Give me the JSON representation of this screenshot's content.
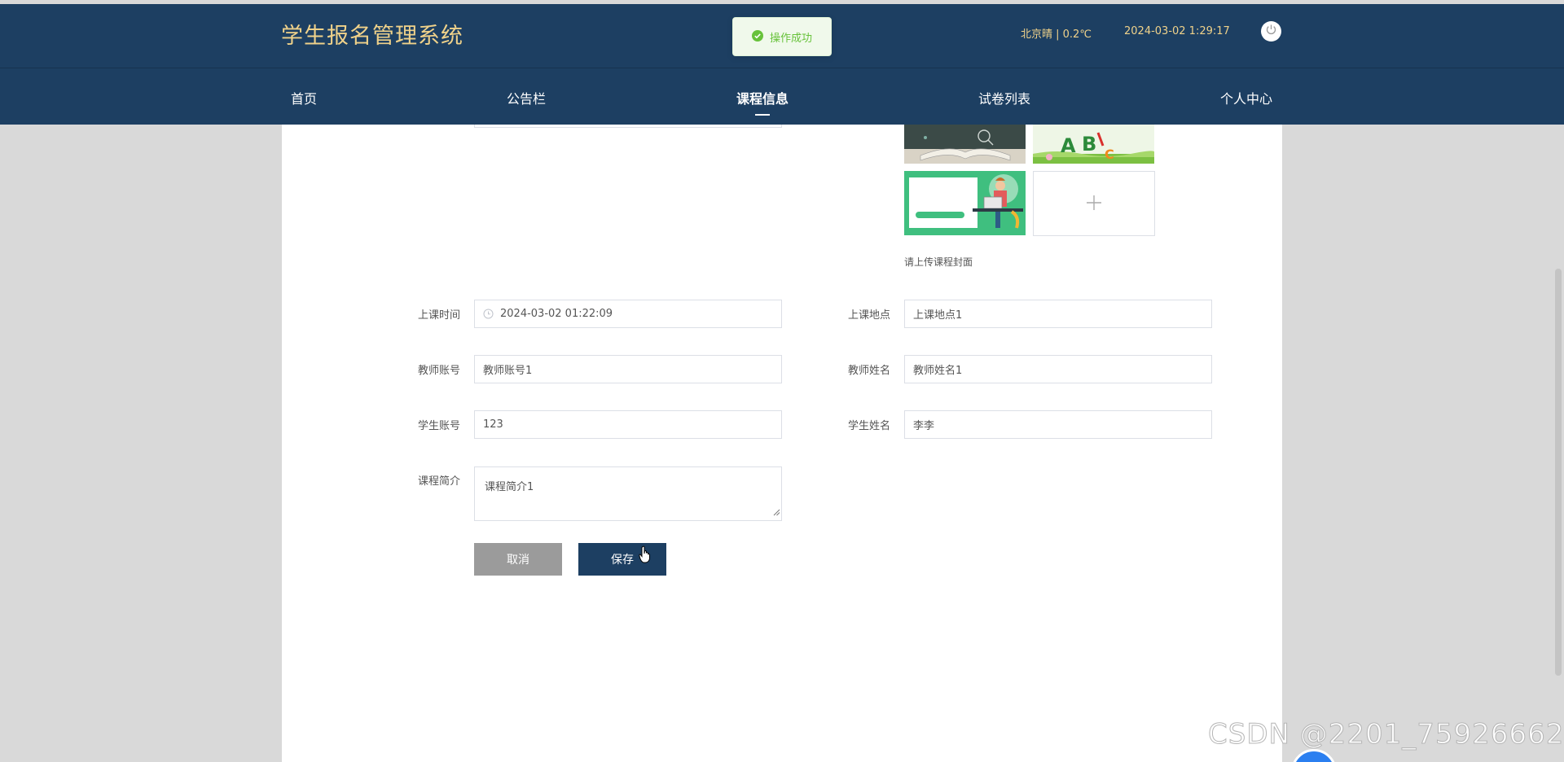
{
  "header": {
    "app_title": "学生报名管理系统",
    "weather": "北京晴 | 0.2℃",
    "datetime": "2024-03-02  1:29:17",
    "toast": "操作成功"
  },
  "nav": {
    "items": [
      {
        "label": "首页"
      },
      {
        "label": "公告栏"
      },
      {
        "label": "课程信息"
      },
      {
        "label": "试卷列表"
      },
      {
        "label": "个人中心"
      }
    ],
    "active": "课程信息"
  },
  "upload": {
    "tip": "请上传课程封面"
  },
  "form": {
    "course_time": {
      "label": "上课时间",
      "value": "2024-03-02 01:22:09"
    },
    "course_location": {
      "label": "上课地点",
      "value": "上课地点1"
    },
    "teacher_account": {
      "label": "教师账号",
      "value": "教师账号1"
    },
    "teacher_name": {
      "label": "教师姓名",
      "value": "教师姓名1"
    },
    "student_account": {
      "label": "学生账号",
      "value": "123"
    },
    "student_name": {
      "label": "学生姓名",
      "value": "李李"
    },
    "course_intro": {
      "label": "课程简介",
      "value": "课程简介1"
    },
    "cancel_label": "取消",
    "save_label": "保存"
  },
  "watermark": "CSDN @2201_75926662",
  "colors": {
    "header_bg": "#1d3f62",
    "title_gold": "#f0d28a",
    "success_green": "#67c23a",
    "cancel_gray": "#9b9b9b"
  }
}
